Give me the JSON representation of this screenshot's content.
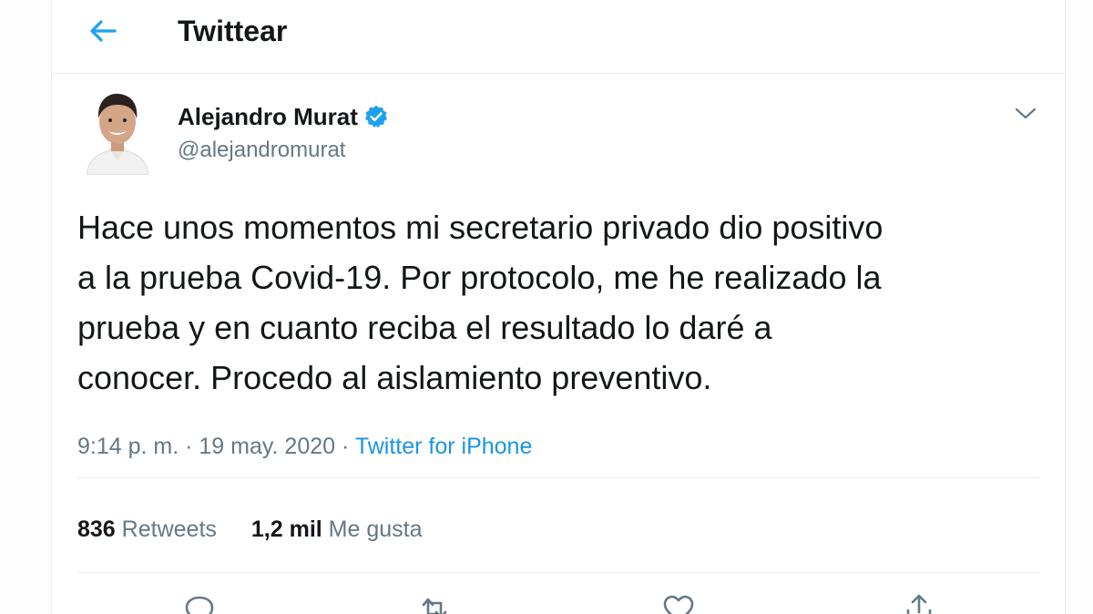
{
  "header": {
    "title": "Twittear",
    "back_icon": "back-arrow-icon",
    "accent": "#1da1f2"
  },
  "tweet": {
    "author": {
      "name": "Alejandro Murat",
      "handle": "@alejandromurat",
      "verified": true
    },
    "text": "Hace unos momentos mi secretario privado dio positivo\na la prueba Covid-19. Por protocolo, me he realizado la\nprueba y en cuanto reciba el resultado lo daré a\nconocer. Procedo al aislamiento preventivo.",
    "time": "9:14 p. m.",
    "separator": "·",
    "date": "19 may. 2020",
    "source": "Twitter for iPhone",
    "stats": {
      "retweets_count": "836",
      "retweets_label": "Retweets",
      "likes_count": "1,2 mil",
      "likes_label": "Me gusta"
    }
  },
  "actions": [
    {
      "name": "reply",
      "icon": "reply-icon"
    },
    {
      "name": "retweet",
      "icon": "retweet-icon"
    },
    {
      "name": "like",
      "icon": "heart-icon"
    },
    {
      "name": "share",
      "icon": "share-icon"
    }
  ],
  "colors": {
    "text": "#14171a",
    "muted": "#657786",
    "link": "#1b95e0",
    "verified": "#1da1f2",
    "border": "#e6ecf0"
  }
}
